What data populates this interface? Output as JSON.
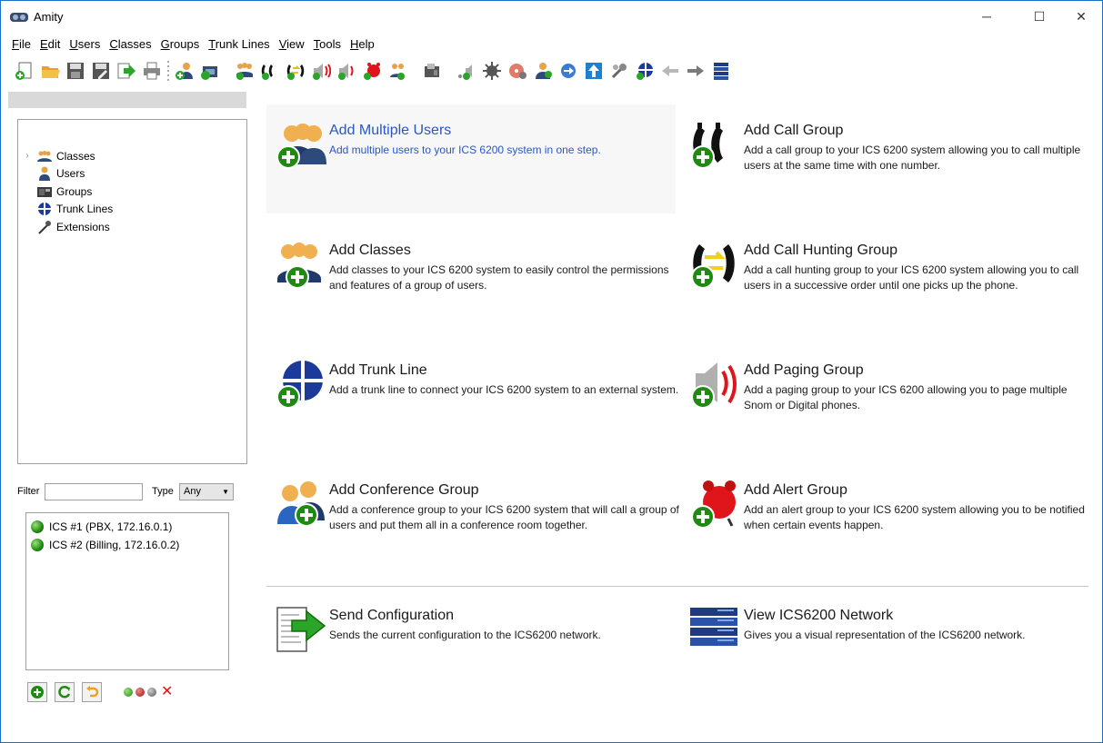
{
  "window": {
    "title": "Amity"
  },
  "window_controls": {
    "minimize": "─",
    "maximize": "☐",
    "close": "✕"
  },
  "menu": [
    {
      "first": "F",
      "rest": "ile"
    },
    {
      "first": "E",
      "rest": "dit"
    },
    {
      "first": "U",
      "rest": "sers"
    },
    {
      "first": "C",
      "rest": "lasses"
    },
    {
      "first": "G",
      "rest": "roups"
    },
    {
      "first": "T",
      "rest": "runk Lines"
    },
    {
      "first": "V",
      "rest": "iew"
    },
    {
      "first": "T",
      "rest": "ools"
    },
    {
      "first": "H",
      "rest": "elp"
    }
  ],
  "tree": {
    "items": [
      {
        "label": "Classes",
        "icon": "classes-icon",
        "expandable": true
      },
      {
        "label": "Users",
        "icon": "user-icon"
      },
      {
        "label": "Groups",
        "icon": "groups-icon"
      },
      {
        "label": "Trunk Lines",
        "icon": "trunk-line-icon"
      },
      {
        "label": "Extensions",
        "icon": "extensions-icon"
      }
    ]
  },
  "filter": {
    "label": "Filter",
    "value": "",
    "type_label": "Type",
    "type_value": "Any"
  },
  "servers": [
    {
      "label": "ICS #1 (PBX, 172.16.0.1)",
      "status": "green"
    },
    {
      "label": "ICS #2 (Billing, 172.16.0.2)",
      "status": "green"
    }
  ],
  "tasks": {
    "add_multiple_users": {
      "title": "Add Multiple Users",
      "desc": "Add multiple users to your ICS 6200 system in one step."
    },
    "add_call_group": {
      "title": "Add Call Group",
      "desc": "Add a call group to your ICS 6200 system allowing you to call multiple users at the same time with one number."
    },
    "add_classes": {
      "title": "Add Classes",
      "desc": "Add classes to your ICS 6200 system to easily control the permissions and features of a group of users."
    },
    "add_call_hunting_group": {
      "title": "Add Call Hunting Group",
      "desc": "Add a call hunting group to your ICS 6200 system allowing you to call users in a successive order until one picks up the phone."
    },
    "add_trunk_line": {
      "title": "Add Trunk Line",
      "desc": "Add a trunk line to connect your ICS 6200 system to an external system."
    },
    "add_paging_group": {
      "title": "Add Paging Group",
      "desc": "Add a paging group to your ICS 6200 allowing you to page multiple Snom or Digital phones."
    },
    "add_conference_group": {
      "title": "Add Conference Group",
      "desc": "Add a conference group to your ICS 6200 system that will call a group of users and put them all in a conference room together."
    },
    "add_alert_group": {
      "title": "Add Alert Group",
      "desc": "Add an alert group to your ICS 6200 system allowing you to be notified when certain events happen."
    },
    "send_configuration": {
      "title": "Send Configuration",
      "desc": "Sends the current configuration to the ICS6200 network."
    },
    "view_network": {
      "title": "View ICS6200 Network",
      "desc": "Gives you a visual representation of the ICS6200 network."
    }
  },
  "colors": {
    "accent": "#2a56c6",
    "window_border": "#1a6fc9",
    "green": "#1f8a12",
    "alert_red": "#e0141b"
  }
}
